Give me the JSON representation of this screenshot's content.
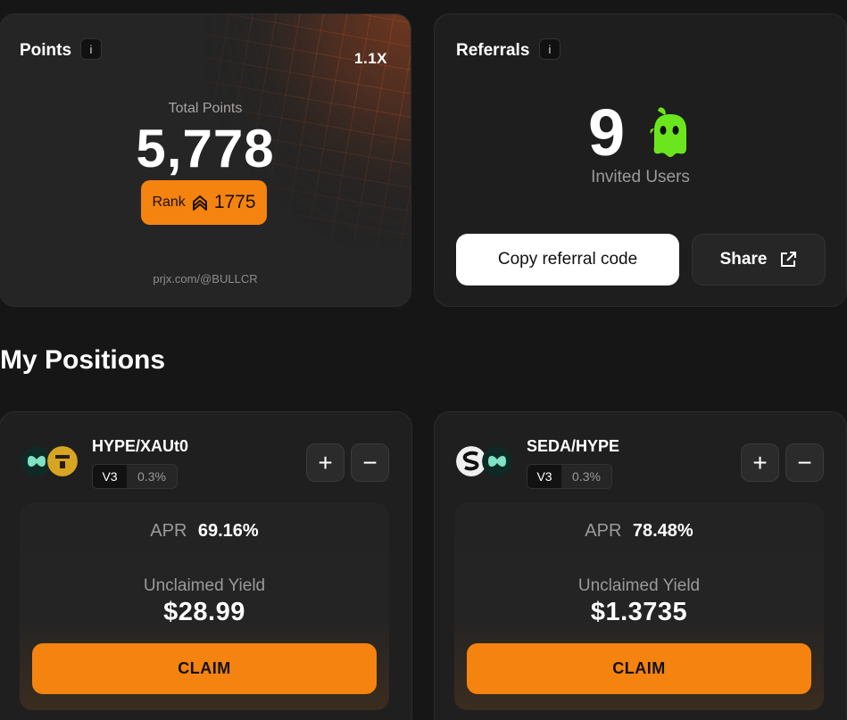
{
  "points": {
    "title": "Points",
    "info": "i",
    "multiplier": "1.1X",
    "total_label": "Total Points",
    "total_value": "5,778",
    "rank_label": "Rank",
    "rank_value": "1775",
    "profile_link": "prjx.com/@BULLCR"
  },
  "referrals": {
    "title": "Referrals",
    "info": "i",
    "count": "9",
    "invited_label": "Invited Users",
    "copy_label": "Copy referral code",
    "share_label": "Share"
  },
  "section_title": "My Positions",
  "positions": [
    {
      "pair": "HYPE/XAUt0",
      "version": "V3",
      "fee": "0.3%",
      "plus": "+",
      "minus": "−",
      "apr_label": "APR",
      "apr": "69.16%",
      "yield_label": "Unclaimed Yield",
      "yield": "$28.99",
      "claim_label": "CLAIM"
    },
    {
      "pair": "SEDA/HYPE",
      "version": "V3",
      "fee": "0.3%",
      "plus": "+",
      "minus": "−",
      "apr_label": "APR",
      "apr": "78.48%",
      "yield_label": "Unclaimed Yield",
      "yield": "$1.3735",
      "claim_label": "CLAIM"
    }
  ],
  "colors": {
    "accent": "#f5830f",
    "mascot": "#6be61e",
    "hype_token": "#7ee2c4",
    "xaut_token": "#d7a521"
  }
}
